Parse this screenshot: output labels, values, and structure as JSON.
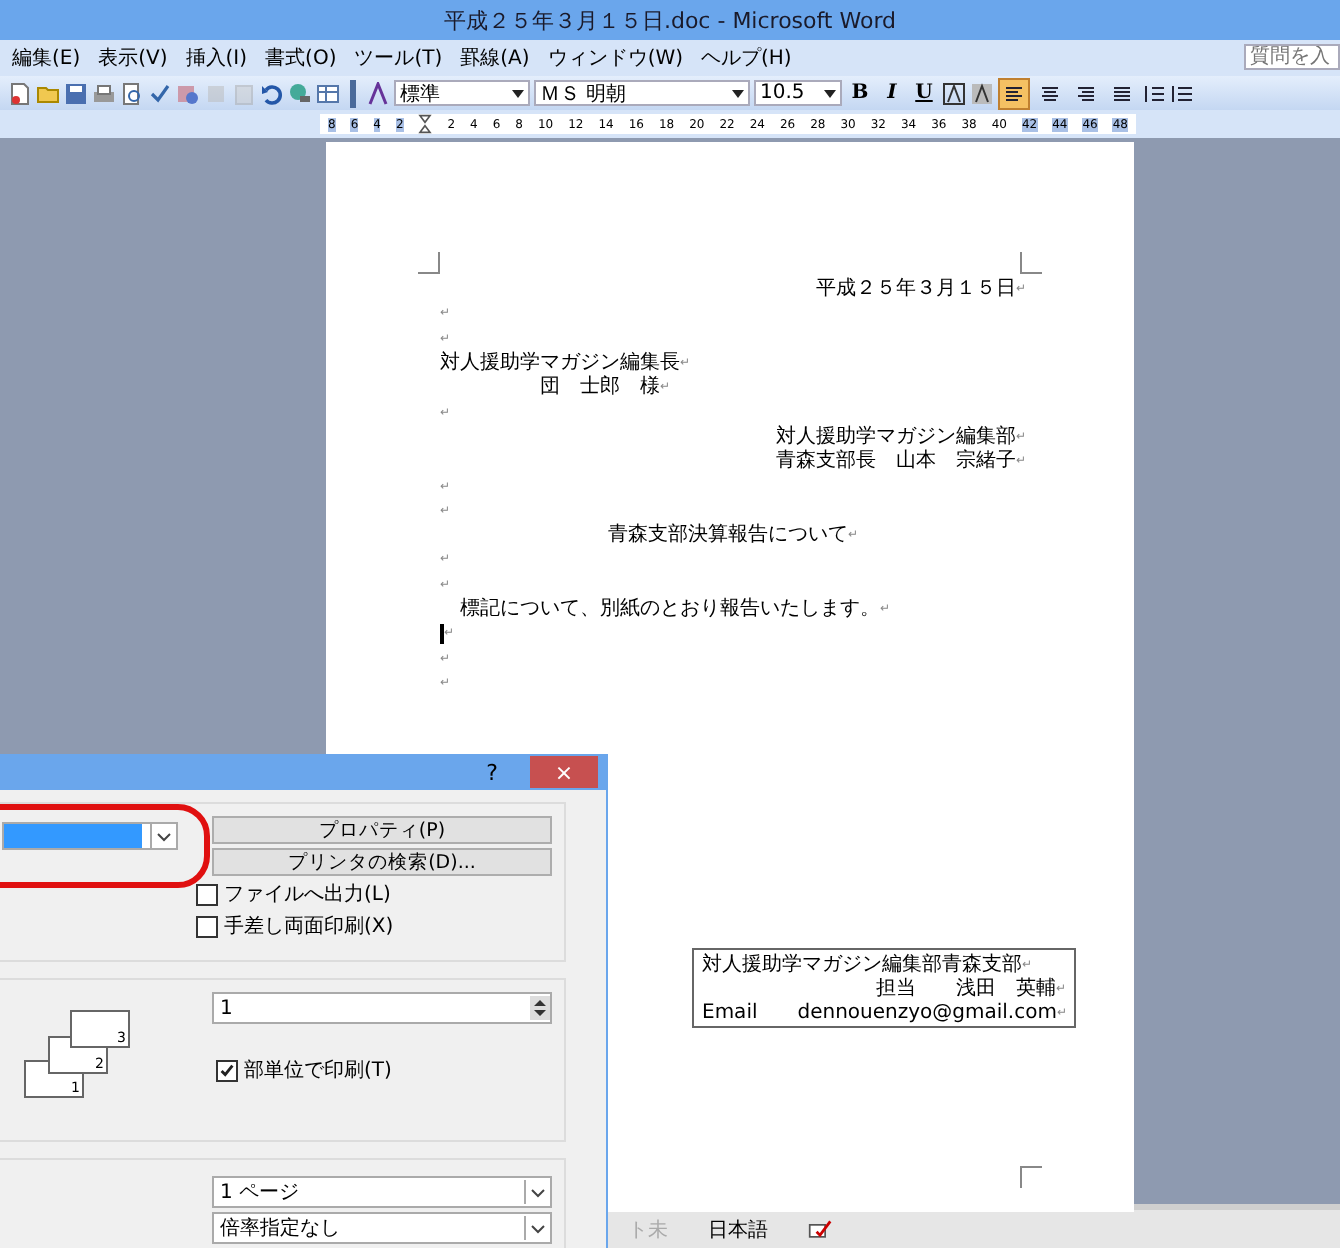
{
  "window": {
    "title": "平成２５年３月１５日.doc - Microsoft Word"
  },
  "menu": [
    "編集(E)",
    "表示(V)",
    "挿入(I)",
    "書式(O)",
    "ツール(T)",
    "罫線(A)",
    "ウィンドウ(W)",
    "ヘルプ(H)"
  ],
  "help_search": {
    "placeholder": "質問を入"
  },
  "toolbar": {
    "style": "標準",
    "font": "ＭＳ 明朝",
    "size": "10.5",
    "format_buttons": [
      {
        "label": "B",
        "selected": false
      },
      {
        "label": "I",
        "selected": false
      },
      {
        "label": "U",
        "selected": false
      }
    ],
    "align_buttons": [
      {
        "selected": true
      },
      {
        "selected": false
      },
      {
        "selected": false
      },
      {
        "selected": false
      }
    ]
  },
  "ruler": {
    "left_ticks": [
      "8",
      "6",
      "4",
      "2"
    ],
    "ticks": [
      "2",
      "4",
      "6",
      "8",
      "10",
      "12",
      "14",
      "16",
      "18",
      "20",
      "22",
      "24",
      "26",
      "28",
      "30",
      "32",
      "34",
      "36",
      "38",
      "40"
    ],
    "right_ticks": [
      "42",
      "44",
      "46",
      "48"
    ]
  },
  "document": {
    "lines": [
      {
        "text": "平成２５年３月１５日",
        "kind": "flushright",
        "mark": "↵"
      },
      {
        "kind": "body",
        "mark": "↵"
      },
      {
        "kind": "body",
        "mark": "↵"
      },
      {
        "text": "対人援助学マガジン編集長",
        "kind": "body",
        "mark": "↵"
      },
      {
        "text": "　　　　　団　士郎　様",
        "kind": "body",
        "mark": "↵"
      },
      {
        "kind": "body",
        "mark": "↵"
      },
      {
        "text": "対人援助学マガジン編集部",
        "kind": "flushright",
        "mark": "↵"
      },
      {
        "text": "青森支部長　山本　宗緒子",
        "kind": "flushright",
        "mark": "↵"
      },
      {
        "kind": "body",
        "mark": "↵"
      },
      {
        "kind": "body",
        "mark": "↵"
      },
      {
        "text": "青森支部決算報告について",
        "kind": "centered",
        "mark": "↵"
      },
      {
        "kind": "body",
        "mark": "↵"
      },
      {
        "kind": "body",
        "mark": "↵"
      },
      {
        "text": "　標記について、別紙のとおり報告いたします。",
        "kind": "body",
        "mark": "↵"
      },
      {
        "kind": "body",
        "mark": "↵",
        "cursor": true
      },
      {
        "kind": "body",
        "mark": "↵"
      },
      {
        "kind": "body",
        "mark": "↵"
      }
    ],
    "contact_box": [
      {
        "text": "対人援助学マガジン編集部青森支部",
        "mark": "↵"
      },
      {
        "text": "担当　　浅田　英輔",
        "mark": "↵"
      },
      {
        "text": "Email　　dennouenzyo@gmail.com",
        "mark": "↵"
      }
    ]
  },
  "status_bar": [
    {
      "text": "ト未",
      "disabled": true
    },
    {
      "text": "日本語",
      "disabled": false
    }
  ],
  "print_dialog": {
    "help": "?",
    "close": "×",
    "printer": {
      "highlighted": true
    },
    "buttons": [
      "プロパティ(P)",
      "プリンタの検索(D)..."
    ],
    "options": [
      {
        "label": "ファイルへ出力(L)",
        "checked": false
      },
      {
        "label": "手差し両面印刷(X)",
        "checked": false
      }
    ],
    "copies": {
      "value": "1"
    },
    "collate": {
      "label": "部単位で印刷(T)",
      "checked": true
    },
    "collate_pages": [
      "1",
      "2",
      "3"
    ],
    "pages_per_sheet": {
      "value": "1 ページ"
    },
    "scale": {
      "value": "倍率指定なし"
    }
  }
}
